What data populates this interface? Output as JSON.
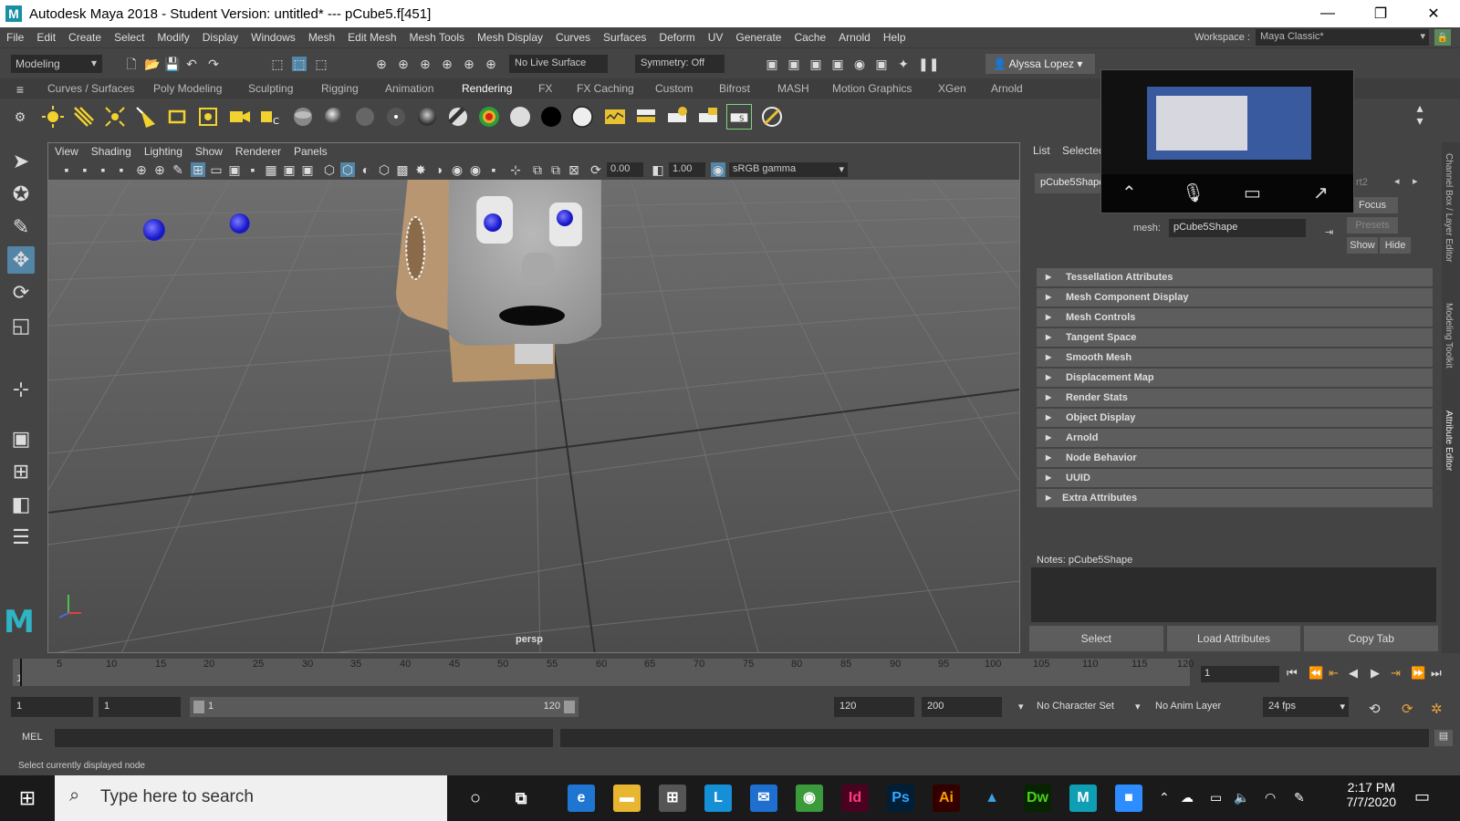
{
  "titlebar": {
    "title": "Autodesk Maya 2018 - Student Version: untitled*   ---   pCube5.f[451]",
    "logo_letter": "M",
    "minimize": "—",
    "restore": "❐",
    "close": "✕"
  },
  "menubar": {
    "items": [
      "File",
      "Edit",
      "Create",
      "Select",
      "Modify",
      "Display",
      "Windows",
      "Mesh",
      "Edit Mesh",
      "Mesh Tools",
      "Mesh Display",
      "Curves",
      "Surfaces",
      "Deform",
      "UV",
      "Generate",
      "Cache",
      "Arnold",
      "Help"
    ],
    "workspace_label": "Workspace :",
    "workspace_value": "Maya Classic*"
  },
  "statusline": {
    "mode": "Modeling",
    "live_surface": "No Live Surface",
    "symmetry": "Symmetry: Off",
    "user": "Alyssa Lopez"
  },
  "shelf": {
    "tabs": [
      "Curves / Surfaces",
      "Poly Modeling",
      "Sculpting",
      "Rigging",
      "Animation",
      "Rendering",
      "FX",
      "FX Caching",
      "Custom",
      "Bifrost",
      "MASH",
      "Motion Graphics",
      "XGen",
      "Arnold"
    ],
    "active_tab": "Rendering"
  },
  "viewport": {
    "menu": [
      "View",
      "Shading",
      "Lighting",
      "Show",
      "Renderer",
      "Panels"
    ],
    "exposure": "0.00",
    "gamma": "1.00",
    "color_space": "sRGB gamma",
    "camera_label": "persp"
  },
  "attribute_editor": {
    "top_tabs": [
      "List",
      "Selected"
    ],
    "node_tab": "pCube5Shape",
    "partial_tab": "rt2",
    "focus": "Focus",
    "presets": "Presets",
    "show": "Show",
    "hide": "Hide",
    "mesh_label": "mesh:",
    "mesh_value": "pCube5Shape",
    "sections": [
      "Tessellation Attributes",
      "Mesh Component Display",
      "Mesh Controls",
      "Tangent Space",
      "Smooth Mesh",
      "Displacement Map",
      "Render Stats",
      "Object Display",
      "Arnold",
      "Node Behavior",
      "UUID",
      "Extra Attributes"
    ],
    "notes_label": "Notes:  pCube5Shape",
    "buttons": [
      "Select",
      "Load Attributes",
      "Copy Tab"
    ]
  },
  "vertical_tabs": [
    "Channel Box / Layer Editor",
    "Modeling Toolkit",
    "Attribute Editor"
  ],
  "timeline": {
    "ticks": [
      "5",
      "10",
      "15",
      "20",
      "25",
      "30",
      "35",
      "40",
      "45",
      "50",
      "55",
      "60",
      "65",
      "70",
      "75",
      "80",
      "85",
      "90",
      "95",
      "100",
      "105",
      "110",
      "115",
      "120"
    ],
    "current_frame": "1",
    "start_marker": "1"
  },
  "range": {
    "start": "1",
    "playback_start": "1",
    "slider_start": "1",
    "slider_end": "120",
    "playback_end": "120",
    "end": "200",
    "character_set": "No Character Set",
    "anim_layer": "No Anim Layer",
    "fps": "24 fps"
  },
  "commandline": {
    "mel": "MEL",
    "help": "Select currently displayed node"
  },
  "taskbar": {
    "search_placeholder": "Type here to search",
    "time": "2:17 PM",
    "date": "7/7/2020",
    "apps": [
      {
        "name": "edge",
        "label": "e",
        "color": "#1e76d2"
      },
      {
        "name": "explorer",
        "label": "▬",
        "color": "#e8b630"
      },
      {
        "name": "store",
        "label": "⊞",
        "color": "#555555"
      },
      {
        "name": "l-app",
        "label": "L",
        "color": "#1590d6"
      },
      {
        "name": "mail",
        "label": "✉",
        "color": "#1f6fd0"
      },
      {
        "name": "chrome",
        "label": "◉",
        "color": "#3b9b3b"
      },
      {
        "name": "indesign",
        "label": "Id",
        "color": "#49021f"
      },
      {
        "name": "photoshop",
        "label": "Ps",
        "color": "#001e36"
      },
      {
        "name": "illustrator",
        "label": "Ai",
        "color": "#330000"
      },
      {
        "name": "app-blue",
        "label": "▲",
        "color": "#1a1a1a"
      },
      {
        "name": "dreamweaver",
        "label": "Dw",
        "color": "#072401"
      },
      {
        "name": "maya",
        "label": "M",
        "color": "#0f9fb5"
      },
      {
        "name": "zoom",
        "label": "■",
        "color": "#2d8cff"
      }
    ]
  }
}
